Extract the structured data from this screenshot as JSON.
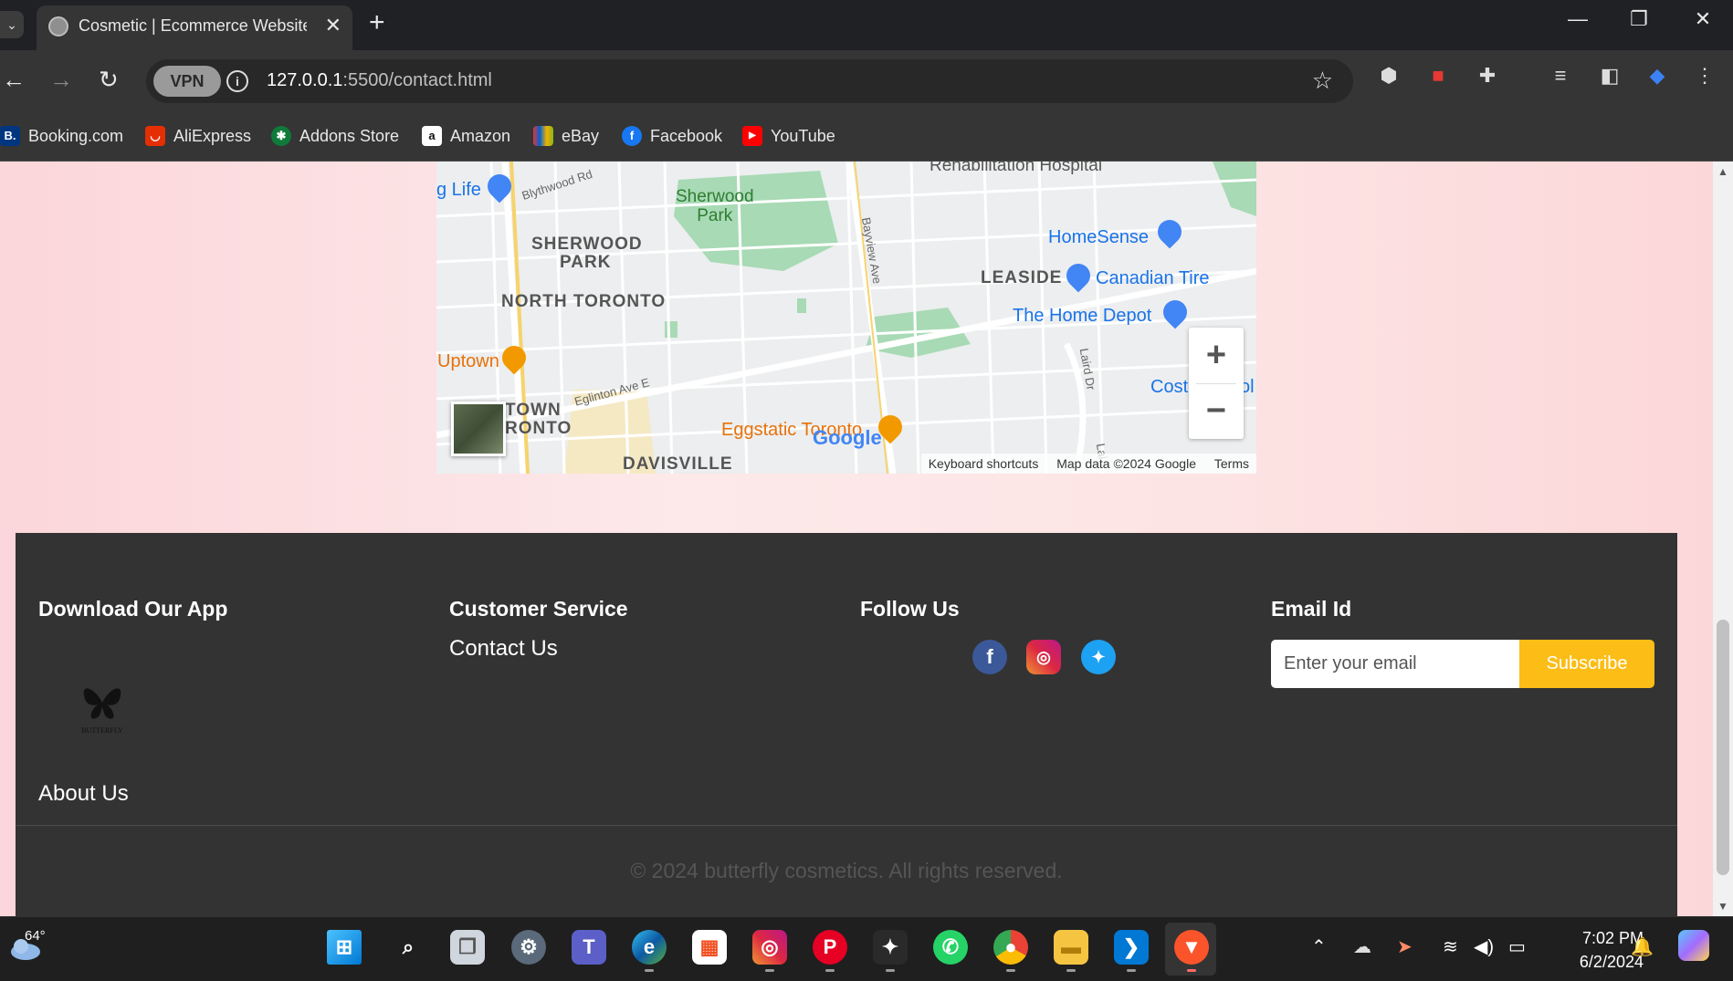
{
  "browser": {
    "tab": {
      "title": "Cosmetic | Ecommerce Website",
      "close": "✕"
    },
    "new_tab": "+",
    "window": {
      "minimize": "—",
      "restore": "❐",
      "close": "✕"
    },
    "nav": {
      "back": "←",
      "forward": "→",
      "reload": "↻"
    },
    "omnibox": {
      "vpn_label": "VPN",
      "info": "i",
      "url_host": "127.0.0.1",
      "url_path": ":5500/contact.html",
      "star": "☆"
    },
    "extensions": [
      "shield-extension-icon",
      "lock-extension-icon",
      "puzzle-icon",
      "media-icon",
      "side-panel-icon",
      "bitwarden-icon",
      "menu-dots-icon"
    ],
    "bookmarks": [
      {
        "label": "Booking.com",
        "icon": "B.",
        "color": "#003580"
      },
      {
        "label": "AliExpress",
        "icon": "◡",
        "color": "#e62e04"
      },
      {
        "label": "Addons Store",
        "icon": "✱",
        "color": "#0f7a3a"
      },
      {
        "label": "Amazon",
        "icon": "a",
        "color": "#ffffff"
      },
      {
        "label": "eBay",
        "icon": "▦",
        "color": "#e53238"
      },
      {
        "label": "Facebook",
        "icon": "f",
        "color": "#1877f2"
      },
      {
        "label": "YouTube",
        "icon": "▶",
        "color": "#ff0000"
      }
    ]
  },
  "map": {
    "labels": {
      "life": "g Life",
      "blythwood": "Blythwood Rd",
      "rehab": "Rehabilitation Hospital",
      "sherwood_park_green": "Sherwood\nPark",
      "sherwood_park": "SHERWOOD",
      "sherwood_park2": "PARK",
      "north_toronto": "NORTH TORONTO",
      "bayview": "Bayview Ave",
      "homesense": "HomeSense",
      "leaside": "LEASIDE",
      "canadian_tire": "Canadian Tire",
      "home_depot": "The Home Depot",
      "uptown": "Uptown",
      "laird": "Laird Dr",
      "costco": "Cost",
      "costco_end": "ol",
      "eglinton": "Eglinton Ave E",
      "downtown1": "TOWN",
      "downtown2": "RONTO",
      "eggstatic": "Eggstatic Toronto",
      "davisville": "DAVISVILLE",
      "lai": "Lai"
    },
    "zoom_in": "+",
    "zoom_out": "−",
    "google": "Google",
    "footer": {
      "shortcuts": "Keyboard shortcuts",
      "data": "Map data ©2024 Google",
      "terms": "Terms"
    }
  },
  "footer": {
    "download": {
      "heading": "Download Our App",
      "logo_text": "BUTTERFLY",
      "about": "About Us"
    },
    "service": {
      "heading": "Customer Service",
      "contact": "Contact Us"
    },
    "follow": {
      "heading": "Follow Us"
    },
    "email": {
      "heading": "Email Id",
      "placeholder": "Enter your email",
      "button": "Subscribe"
    },
    "copyright": "© 2024 butterfly cosmetics. All rights reserved."
  },
  "taskbar": {
    "temp": "64°",
    "apps": [
      "windows-start-icon",
      "search-icon",
      "task-view-icon",
      "settings-icon",
      "teams-icon",
      "edge-icon",
      "store-icon",
      "instagram-icon",
      "pinterest-icon",
      "wolf-app-icon",
      "whatsapp-icon",
      "chrome-icon",
      "file-explorer-icon",
      "vscode-icon",
      "brave-icon"
    ],
    "time": "7:02 PM",
    "date": "6/2/2024"
  },
  "colors": {
    "accent": "#fbbd16",
    "footer_bg": "#333333",
    "page_bg": "#fde4e4"
  }
}
